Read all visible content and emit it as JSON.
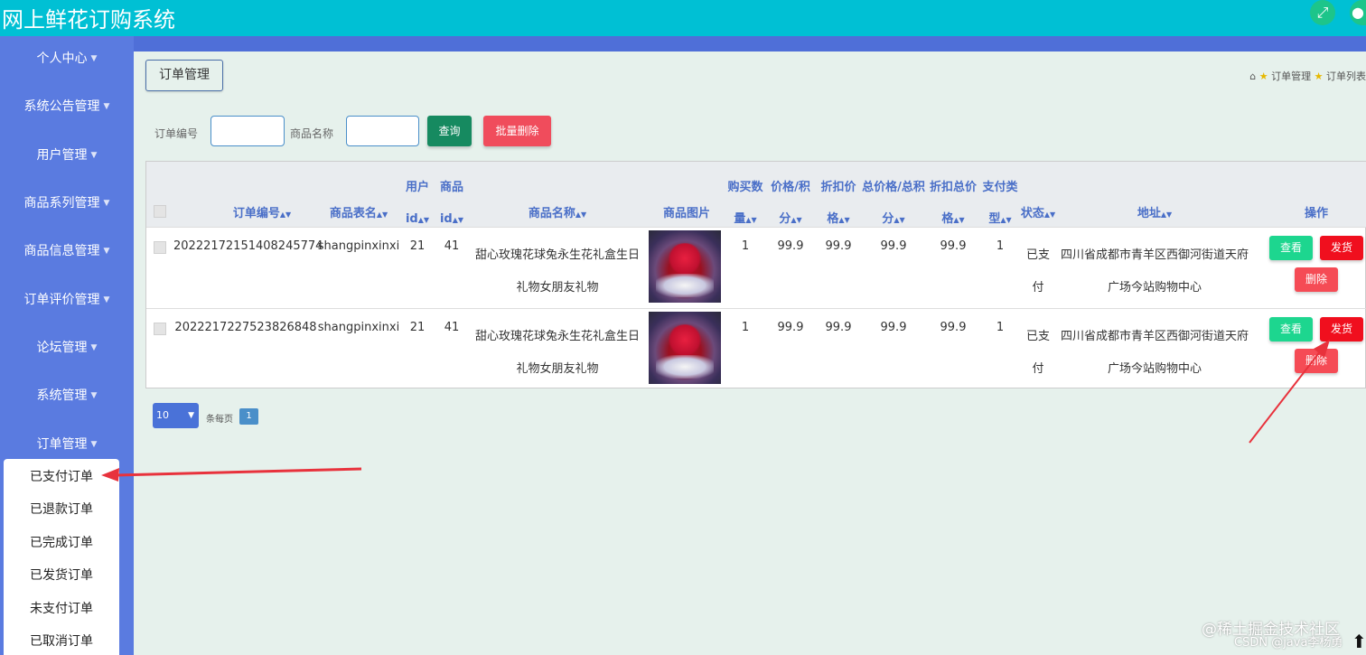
{
  "app": {
    "title": "网上鲜花订购系统",
    "fullscreen_icon": "fullscreen-icon",
    "user_icon": "user-icon"
  },
  "sidebar": {
    "items": [
      {
        "label": "个人中心"
      },
      {
        "label": "系统公告管理"
      },
      {
        "label": "用户管理"
      },
      {
        "label": "商品系列管理"
      },
      {
        "label": "商品信息管理"
      },
      {
        "label": "订单评价管理"
      },
      {
        "label": "论坛管理"
      },
      {
        "label": "系统管理"
      },
      {
        "label": "订单管理"
      }
    ],
    "submenu": [
      {
        "label": "已支付订单"
      },
      {
        "label": "已退款订单"
      },
      {
        "label": "已完成订单"
      },
      {
        "label": "已发货订单"
      },
      {
        "label": "未支付订单"
      },
      {
        "label": "已取消订单"
      }
    ]
  },
  "header": {
    "section_title": "订单管理",
    "breadcrumb": [
      "订单管理",
      "订单列表"
    ]
  },
  "search": {
    "order_no_label": "订单编号",
    "order_no_value": "",
    "product_name_label": "商品名称",
    "product_name_value": "",
    "query_button": "查询",
    "batch_delete_button": "批量删除"
  },
  "table": {
    "headers": {
      "order_no": "订单编号",
      "table_name": "商品表名",
      "user_id_1": "用户",
      "user_id_2": "id",
      "goods_id_1": "商品",
      "goods_id_2": "id",
      "goods_name": "商品名称",
      "goods_image": "商品图片",
      "qty_1": "购买数",
      "qty_2": "量",
      "price_1": "价格/积",
      "price_2": "分",
      "discount_1": "折扣价",
      "discount_2": "格",
      "total_1": "总价格/总积",
      "total_2": "分",
      "disc_total_1": "折扣总价",
      "disc_total_2": "格",
      "pay_type_1": "支付类",
      "pay_type_2": "型",
      "status": "状态",
      "address": "地址",
      "actions": "操作"
    },
    "rows": [
      {
        "order_no": "2022217215140824577​4",
        "table_name": "shangpinxinxi",
        "user_id": "21",
        "goods_id": "41",
        "goods_name_1": "甜心玫瑰花球兔永生花礼盒生日",
        "goods_name_2": "礼物女朋友礼物",
        "qty": "1",
        "price": "99.9",
        "discount": "99.9",
        "total": "99.9",
        "disc_total": "99.9",
        "pay_type": "1",
        "status_1": "已支",
        "status_2": "付",
        "address_1": "四川省成都市青羊区西御河街道天府",
        "address_2": "广场今站购物中心",
        "view": "查看",
        "ship": "发货",
        "delete": "删除"
      },
      {
        "order_no": "2022217227523826848",
        "table_name": "shangpinxinxi",
        "user_id": "21",
        "goods_id": "41",
        "goods_name_1": "甜心玫瑰花球兔永生花礼盒生日",
        "goods_name_2": "礼物女朋友礼物",
        "qty": "1",
        "price": "99.9",
        "discount": "99.9",
        "total": "99.9",
        "disc_total": "99.9",
        "pay_type": "1",
        "status_1": "已支",
        "status_2": "付",
        "address_1": "四川省成都市青羊区西御河街道天府",
        "address_2": "广场今站购物中心",
        "view": "查看",
        "ship": "发货",
        "delete": "删除"
      }
    ]
  },
  "pagination": {
    "page_size": "10",
    "per_page_label": "条每页",
    "current_page": "1"
  },
  "watermark": {
    "line1": "@稀土掘金技术社区",
    "line2": "CSDN @java李杨勇"
  },
  "colors": {
    "topbar": "#00c0d4",
    "sidebar": "#5a7be0",
    "view_button": "#1dd68f",
    "ship_button": "#f00f1e",
    "delete_button": "#f54b55",
    "query_button": "#168a60",
    "batch_delete_button": "#f04c5c"
  }
}
